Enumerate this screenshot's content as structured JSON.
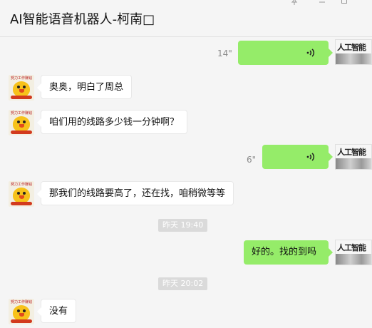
{
  "window": {
    "title": "AI智能语音机器人-柯南□",
    "controls": {
      "pin_icon": "pin-icon",
      "minimize_icon": "minimize-icon",
      "maximize_icon": "maximize-icon"
    }
  },
  "avatars": {
    "left_text": "努力工作赚钱",
    "right_text": "人工智能"
  },
  "messages": [
    {
      "side": "right",
      "kind": "voice",
      "duration": "14\""
    },
    {
      "side": "left",
      "kind": "text",
      "text": "奥奥，明白了周总"
    },
    {
      "side": "left",
      "kind": "text",
      "text": "咱们用的线路多少钱一分钟啊？"
    },
    {
      "side": "right",
      "kind": "voice",
      "duration": "6\""
    },
    {
      "side": "left",
      "kind": "text",
      "text": "那我们的线路要高了，还在找，咱稍微等等"
    },
    {
      "kind": "time",
      "text": "昨天 19:40"
    },
    {
      "side": "right",
      "kind": "text",
      "text": "好的。找的到吗"
    },
    {
      "kind": "time",
      "text": "昨天 20:02"
    },
    {
      "side": "left",
      "kind": "text",
      "text": "没有"
    }
  ],
  "colors": {
    "background": "#f5f5f5",
    "bubble_right": "#95ec69",
    "bubble_left": "#ffffff",
    "timestamp_bg": "#dadada"
  }
}
